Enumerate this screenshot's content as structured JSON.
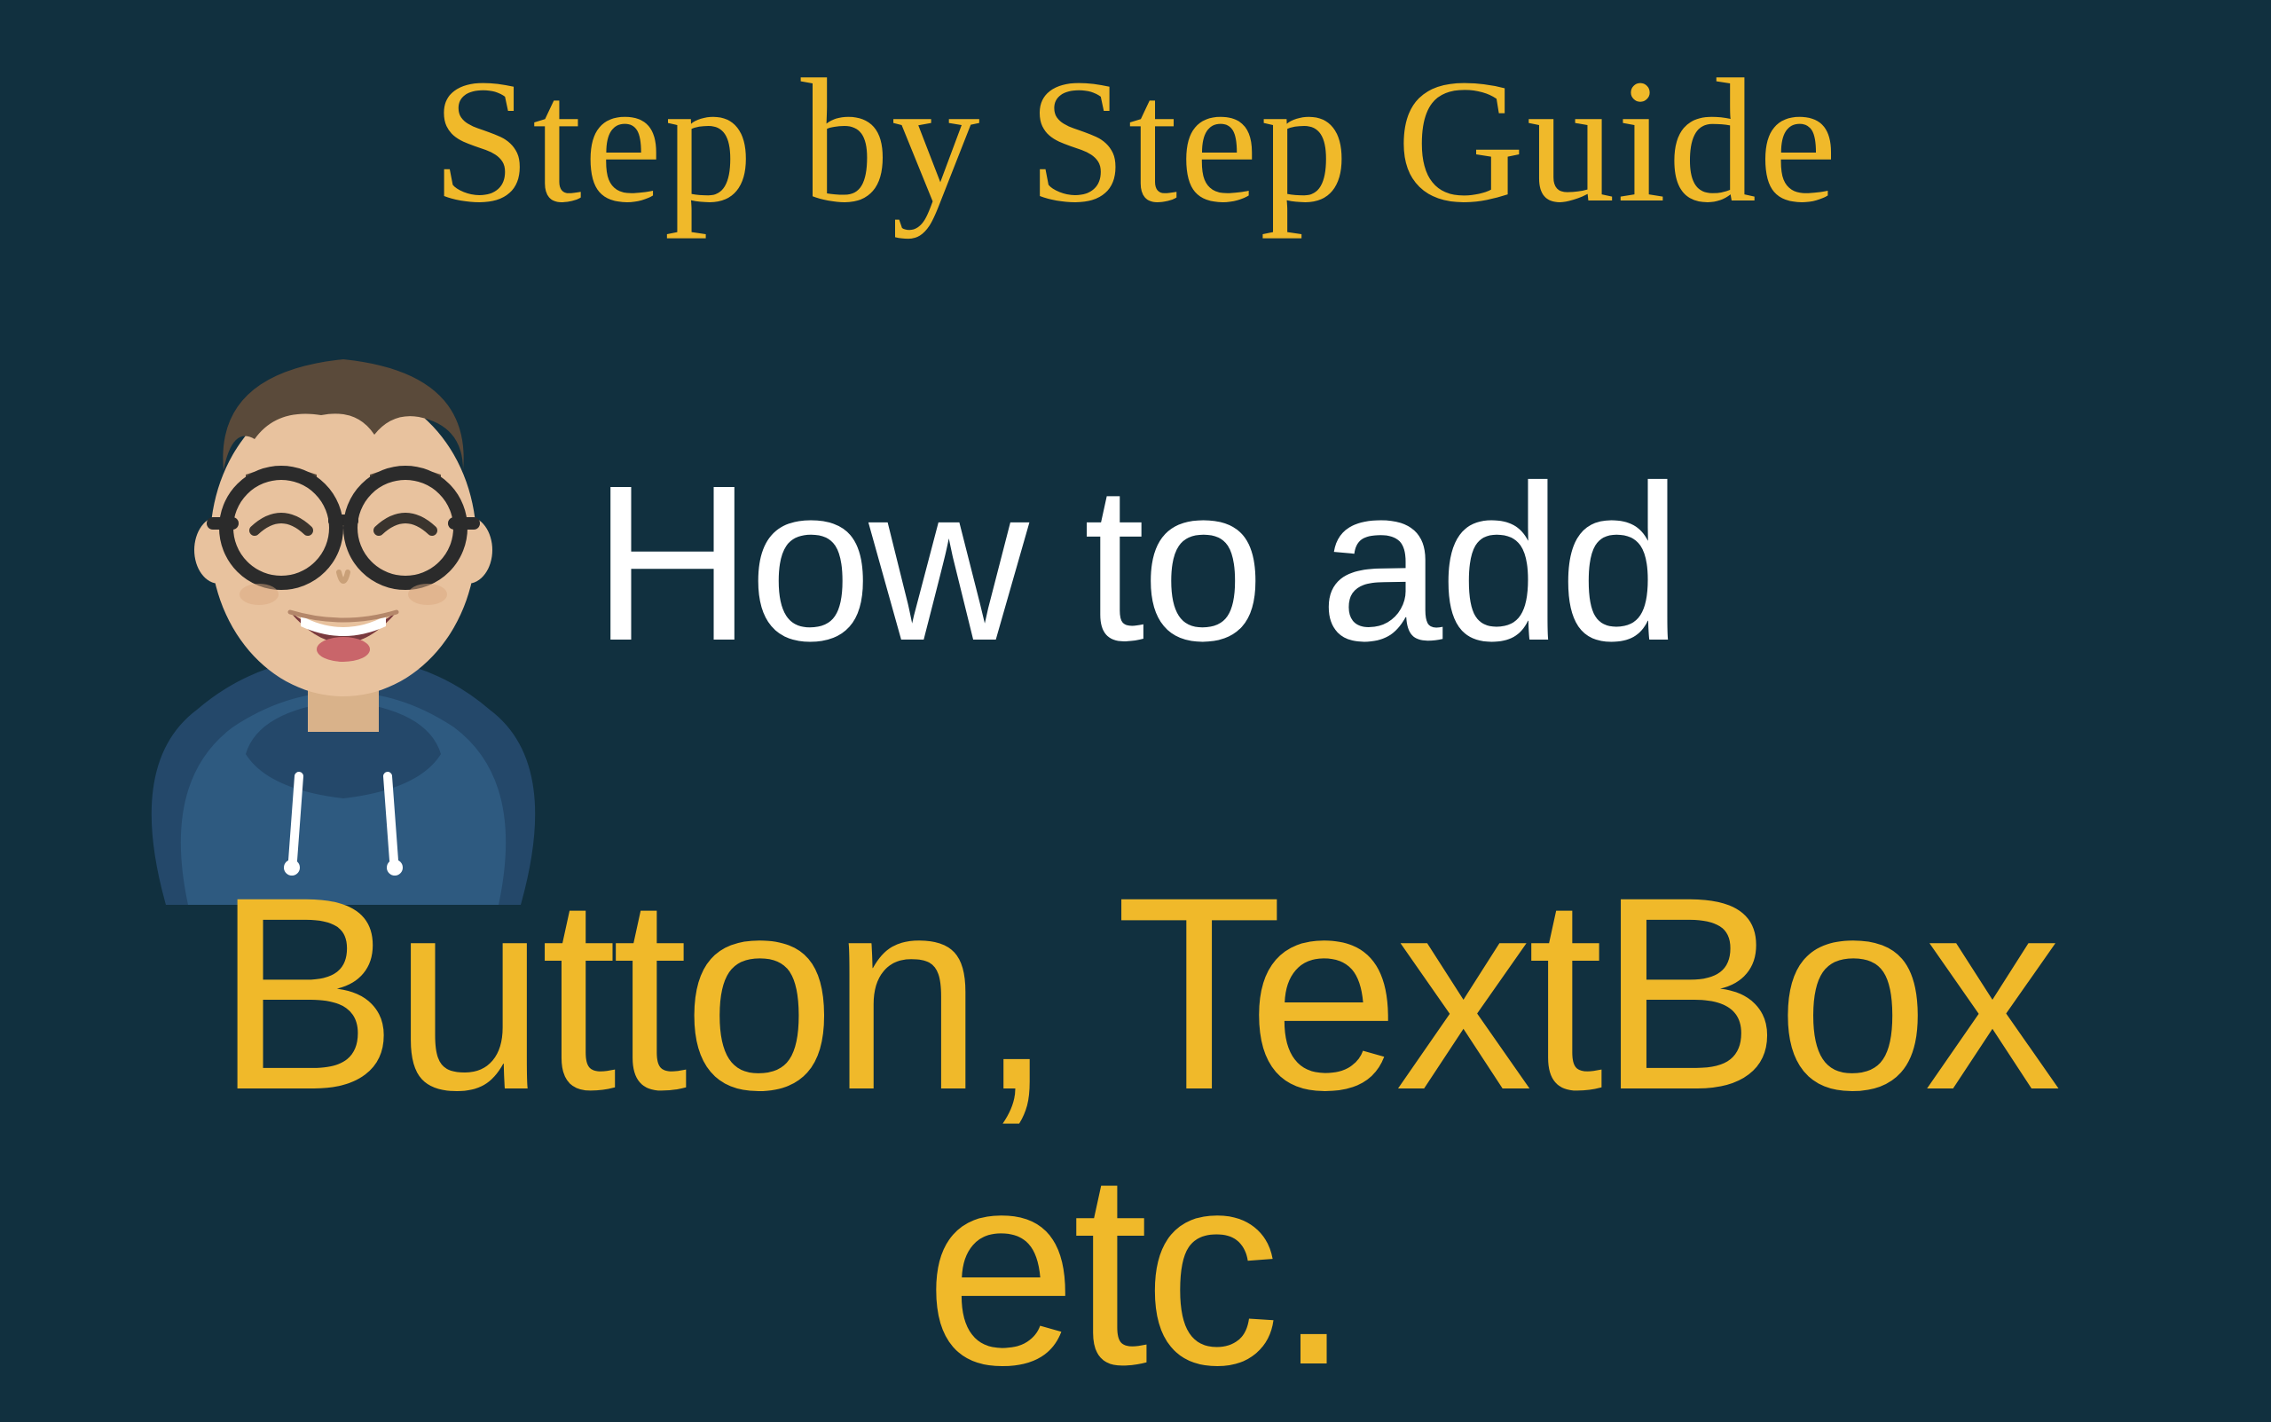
{
  "header": {
    "script_title": "Step by Step Guide"
  },
  "main": {
    "title": "How to add",
    "subtitle": "Button, TextBox etc."
  },
  "colors": {
    "background": "#11303f",
    "accent_yellow": "#f0b92a",
    "text_white": "#ffffff",
    "hoodie": "#2e5a80",
    "skin": "#e8c29e",
    "hair": "#5a4a3a",
    "glasses": "#2b2b2b"
  },
  "avatar": {
    "name": "developer-avatar",
    "description": "cartoon person with glasses and hoodie"
  }
}
